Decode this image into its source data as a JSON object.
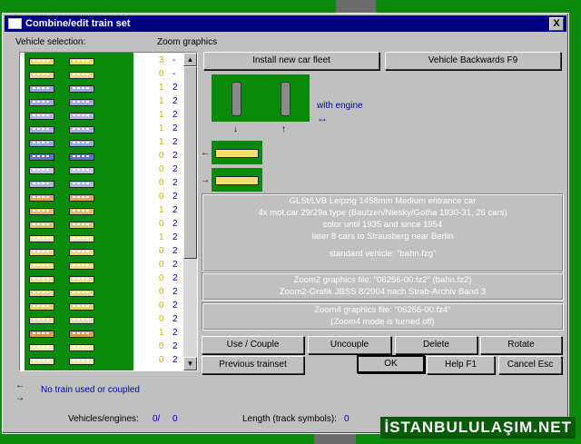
{
  "window": {
    "title": "Combine/edit train set",
    "close_label": "X"
  },
  "labels": {
    "vehicle_selection": "Vehicle selection:",
    "zoom_graphics": "Zoom graphics",
    "with_engine": "with engine",
    "no_train": "No train used or coupled",
    "vehicles_engines": "Vehicles/engines:",
    "vehicles_count": "0/",
    "engines_count": "0",
    "length_label": "Length (track symbols):",
    "length_value": "0"
  },
  "list_rows": [
    {
      "z1": "3",
      "z2": "-",
      "color": "#e8e060"
    },
    {
      "z1": "0",
      "z2": "-",
      "color": "#e0d890"
    },
    {
      "z1": "1",
      "z2": "2",
      "color": "#a0a8e0"
    },
    {
      "z1": "1",
      "z2": "2",
      "color": "#a0a8e0"
    },
    {
      "z1": "1",
      "z2": "2",
      "color": "#b0b8e8"
    },
    {
      "z1": "1",
      "z2": "2",
      "color": "#a8b0e0"
    },
    {
      "z1": "1",
      "z2": "2",
      "color": "#a0a8e0"
    },
    {
      "z1": "0",
      "z2": "2",
      "color": "#6070d0"
    },
    {
      "z1": "0",
      "z2": "2",
      "color": "#c0c8e0"
    },
    {
      "z1": "0",
      "z2": "2",
      "color": "#b0b8d8"
    },
    {
      "z1": "0",
      "z2": "2",
      "color": "#e8a070"
    },
    {
      "z1": "1",
      "z2": "2",
      "color": "#e0c060"
    },
    {
      "z1": "0",
      "z2": "2",
      "color": "#d8c870"
    },
    {
      "z1": "1",
      "z2": "2",
      "color": "#f0e8a0"
    },
    {
      "z1": "0",
      "z2": "2",
      "color": "#e8d880"
    },
    {
      "z1": "0",
      "z2": "2",
      "color": "#f0e070"
    },
    {
      "z1": "0",
      "z2": "2",
      "color": "#e8e090"
    },
    {
      "z1": "0",
      "z2": "2",
      "color": "#e0d890"
    },
    {
      "z1": "0",
      "z2": "2",
      "color": "#e8d070"
    },
    {
      "z1": "0",
      "z2": "2",
      "color": "#e0e0a0"
    },
    {
      "z1": "1",
      "z2": "2",
      "color": "#d8a040"
    },
    {
      "z1": "0",
      "z2": "2",
      "color": "#f0e8b0"
    },
    {
      "z1": "0",
      "z2": "2",
      "color": "#e8e8c0"
    }
  ],
  "buttons": {
    "install_fleet": "Install new car fleet",
    "vehicle_backwards": "Vehicle Backwards   F9",
    "use_couple": "Use / Couple",
    "uncouple": "Uncouple",
    "delete": "Delete",
    "rotate": "Rotate",
    "previous_trainset": "Previous trainset",
    "ok": "OK",
    "help": "Help     F1",
    "cancel": "Cancel   Esc"
  },
  "info": {
    "line1": "GLSt/LVB Leipzig   1458mm   Medium entrance car",
    "line2": "4x mot.car 29/29a type (Bautzen/Niesky/Gotha 1930-31, 26 cars)",
    "line3": "color until 1935 and since 1954",
    "line4": "later 8 cars to Strausberg near Berlin",
    "line5": "standard vehicle: \"bahn.fzg\""
  },
  "zoom2": {
    "line1": "Zoom2 graphics file: \"06256-00.fz2\" (bahn.fz2)",
    "line2": "Zoom2-Grafik JBSS 8/2004 nach Strab-Archiv Band 3"
  },
  "zoom4": {
    "line1": "Zoom4 graphics file: \"06256-00.fz4\"",
    "line2": "(Zoom4 mode is turned off)"
  },
  "arrows": {
    "down": "↓",
    "up": "↑",
    "double": "↔",
    "left": "←",
    "right": "→",
    "scroll_up": "▲",
    "scroll_down": "▼"
  },
  "watermark": "İSTANBULULAŞIM.NET",
  "colors": {
    "title_bar": "#000080",
    "dialog": "#c0c0c0",
    "track_green": "#0a8a0a"
  }
}
